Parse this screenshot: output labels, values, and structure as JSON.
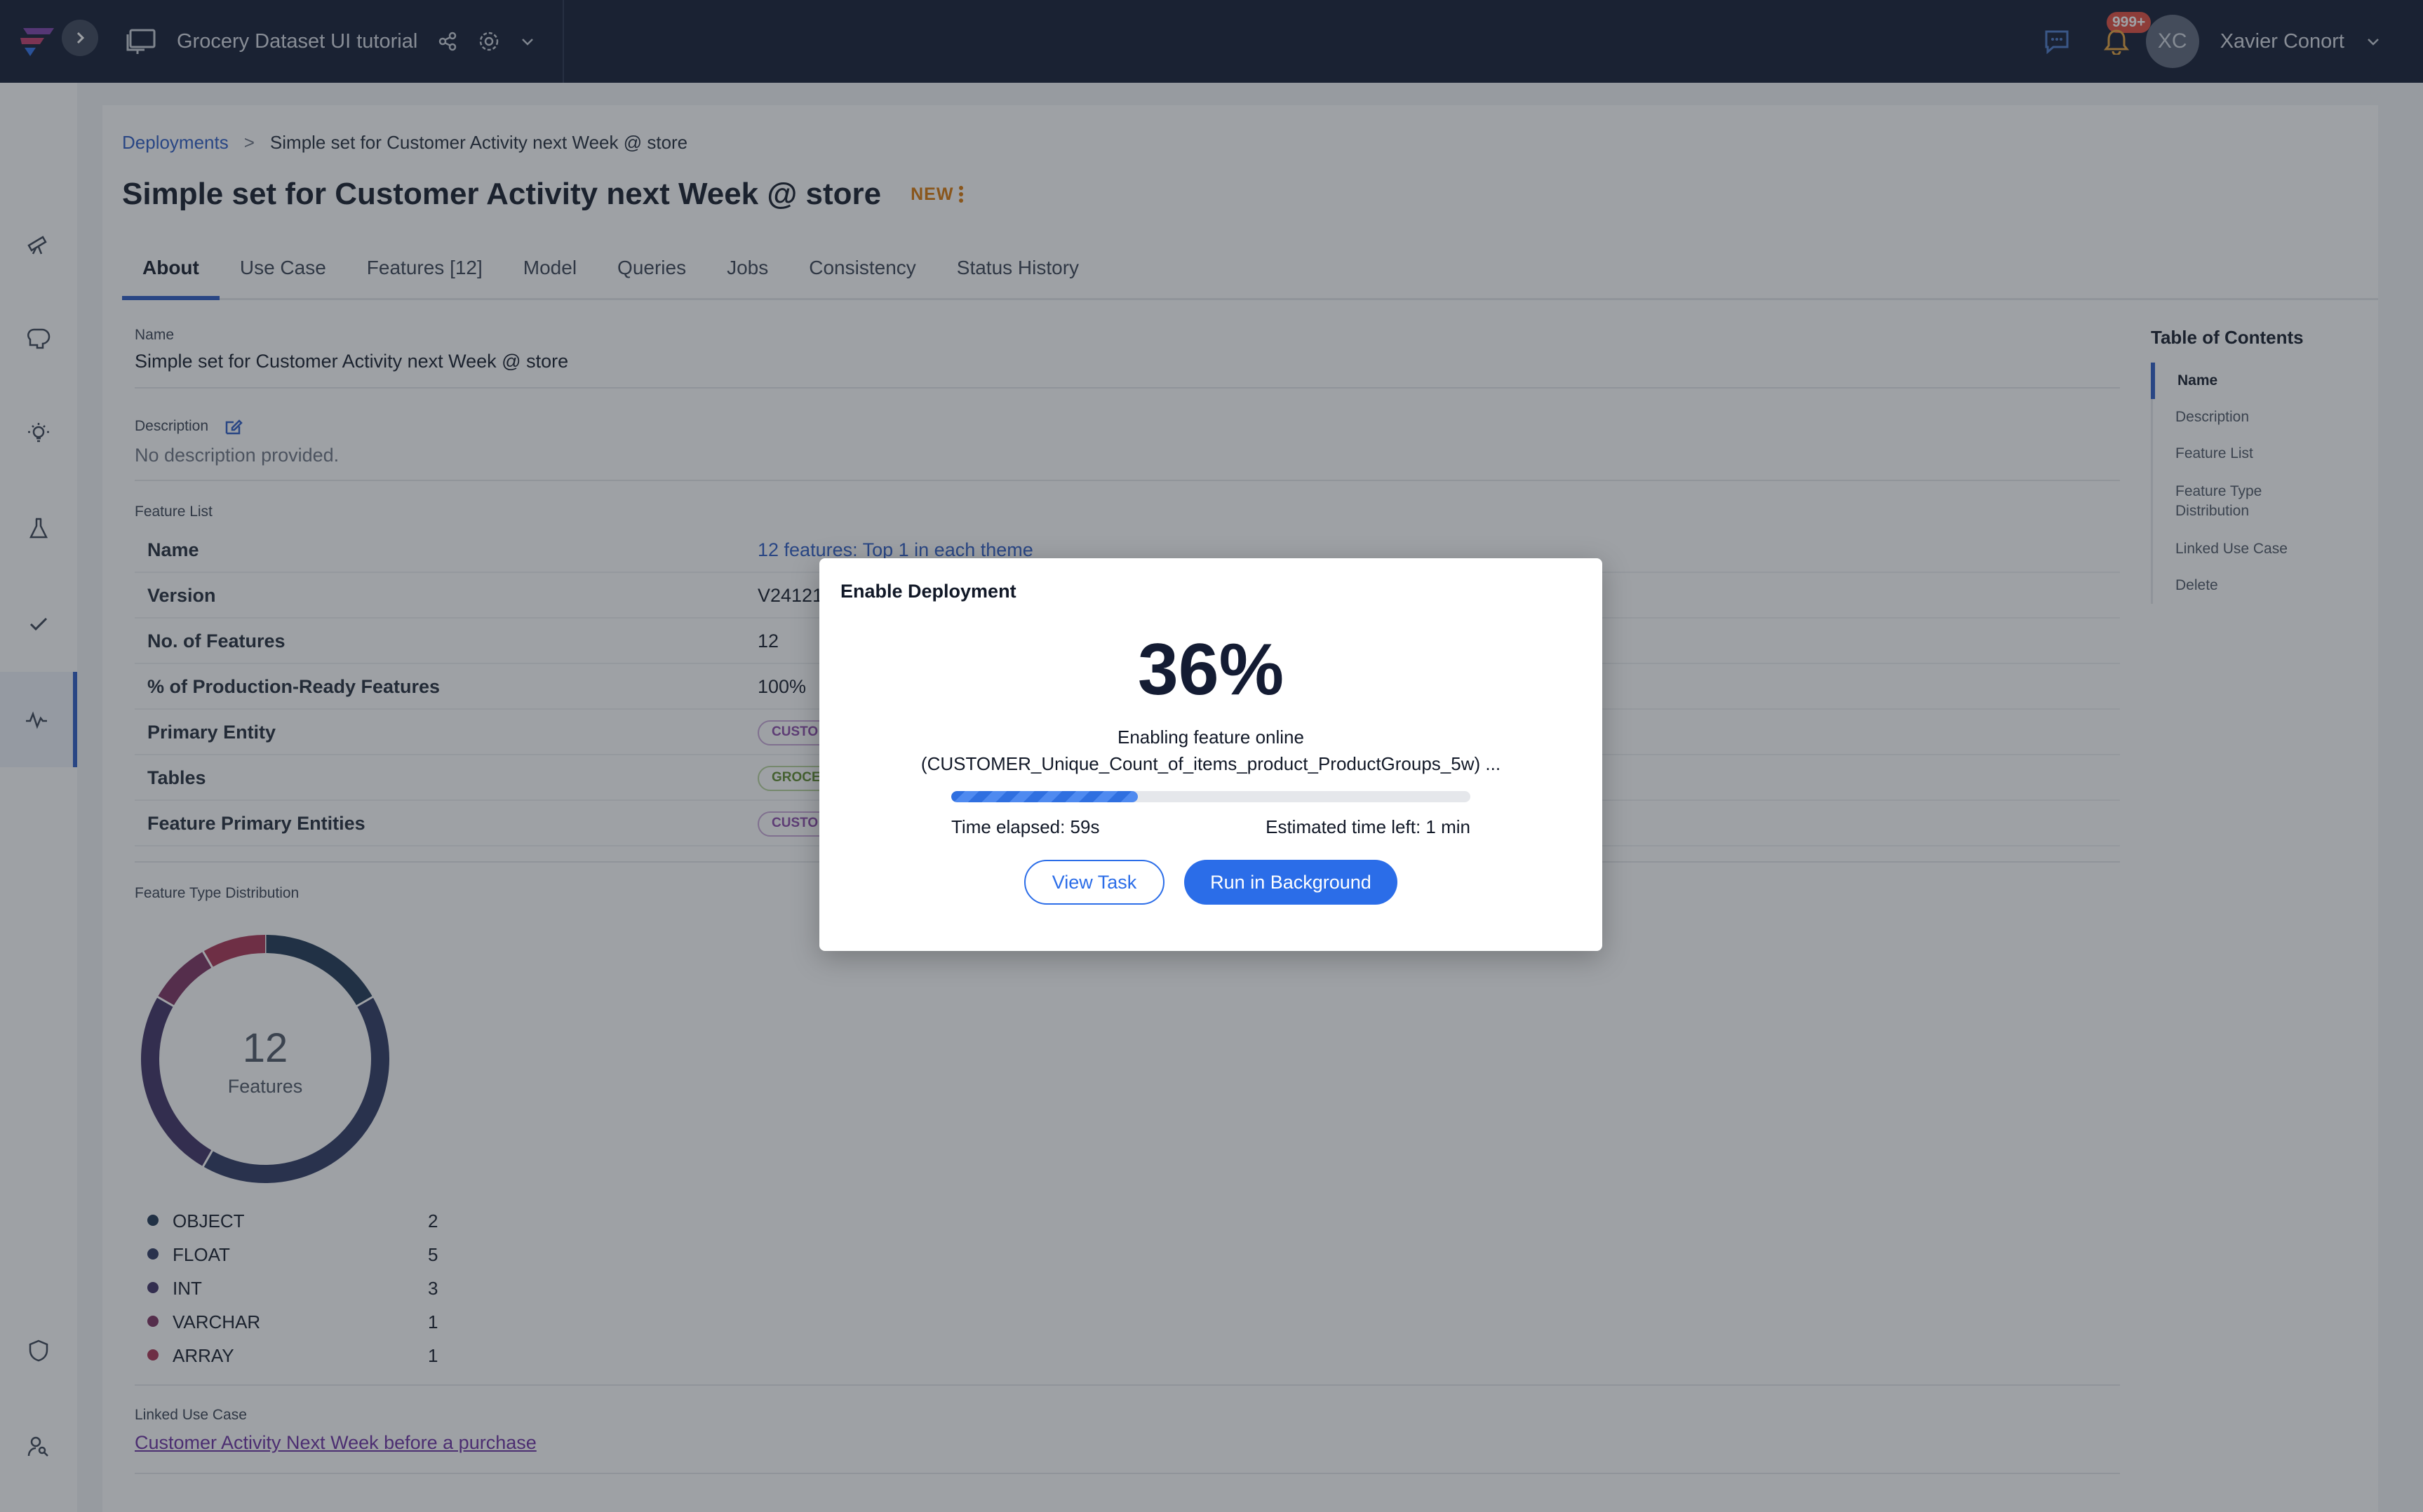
{
  "header": {
    "project_name": "Grocery Dataset UI tutorial",
    "notification_count": "999+",
    "user_initials": "XC",
    "user_name": "Xavier Conort"
  },
  "breadcrumb": {
    "root": "Deployments",
    "separator": ">",
    "current": "Simple set for Customer Activity next Week @ store"
  },
  "page": {
    "title": "Simple set for Customer Activity next Week @ store",
    "status": "NEW"
  },
  "tabs": [
    "About",
    "Use Case",
    "Features [12]",
    "Model",
    "Queries",
    "Jobs",
    "Consistency",
    "Status History"
  ],
  "about": {
    "name_label": "Name",
    "name_value": "Simple set for Customer Activity next Week @ store",
    "description_label": "Description",
    "description_value": "No description provided.",
    "feature_list_label": "Feature List",
    "feature_list_rows": [
      {
        "key": "Name",
        "value": "12 features: Top 1 in each theme"
      },
      {
        "key": "Version",
        "value": "V24121"
      },
      {
        "key": "No. of Features",
        "value": "12"
      },
      {
        "key": "% of Production-Ready Features",
        "value": "100%"
      },
      {
        "key": "Primary Entity",
        "value": "CUSTO"
      },
      {
        "key": "Tables",
        "value": "GROCE"
      },
      {
        "key": "Feature Primary Entities",
        "value": "CUSTO"
      }
    ],
    "distribution_label": "Feature Type Distribution",
    "donut_total": "12",
    "donut_caption": "Features",
    "linked_use_case_label": "Linked Use Case",
    "linked_use_case_value": "Customer Activity Next Week before a purchase"
  },
  "chart_data": {
    "type": "pie",
    "categories": [
      "OBJECT",
      "FLOAT",
      "INT",
      "VARCHAR",
      "ARRAY"
    ],
    "values": [
      2,
      5,
      3,
      1,
      1
    ],
    "colors": [
      "#1c3450",
      "#2a3560",
      "#3d2e63",
      "#7a2f5e",
      "#a83150"
    ]
  },
  "toc": {
    "title": "Table of Contents",
    "items": [
      "Name",
      "Description",
      "Feature List",
      "Feature Type Distribution",
      "Linked Use Case",
      "Delete"
    ]
  },
  "modal": {
    "title": "Enable Deployment",
    "percent": "36%",
    "progress": 0.36,
    "status_line1": "Enabling feature online",
    "status_line2": "(CUSTOMER_Unique_Count_of_items_product_ProductGroups_5w) ...",
    "elapsed": "Time elapsed: 59s",
    "eta": "Estimated time left: 1 min",
    "view_task": "View Task",
    "run_background": "Run in Background"
  }
}
